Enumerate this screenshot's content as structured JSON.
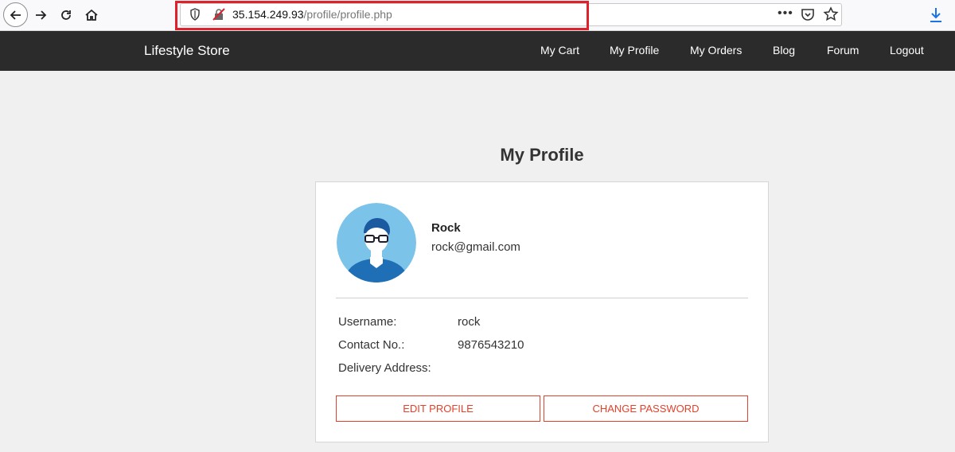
{
  "browser": {
    "url_host": "35.154.249.93",
    "url_path": "/profile/profile.php"
  },
  "sitenav": {
    "brand": "Lifestyle Store",
    "links": [
      "My Cart",
      "My Profile",
      "My Orders",
      "Blog",
      "Forum",
      "Logout"
    ]
  },
  "profile": {
    "title": "My Profile",
    "name": "Rock",
    "email": "rock@gmail.com",
    "fields": [
      {
        "label": "Username:",
        "value": "rock"
      },
      {
        "label": "Contact No.:",
        "value": "9876543210"
      },
      {
        "label": "Delivery Address:",
        "value": ""
      }
    ],
    "edit_button": "EDIT PROFILE",
    "password_button": "CHANGE PASSWORD"
  },
  "colors": {
    "accent": "#e4412b",
    "navbar": "#2b2b2b",
    "highlight": "#e0202a",
    "avatar_bg": "#7cc3ea"
  }
}
